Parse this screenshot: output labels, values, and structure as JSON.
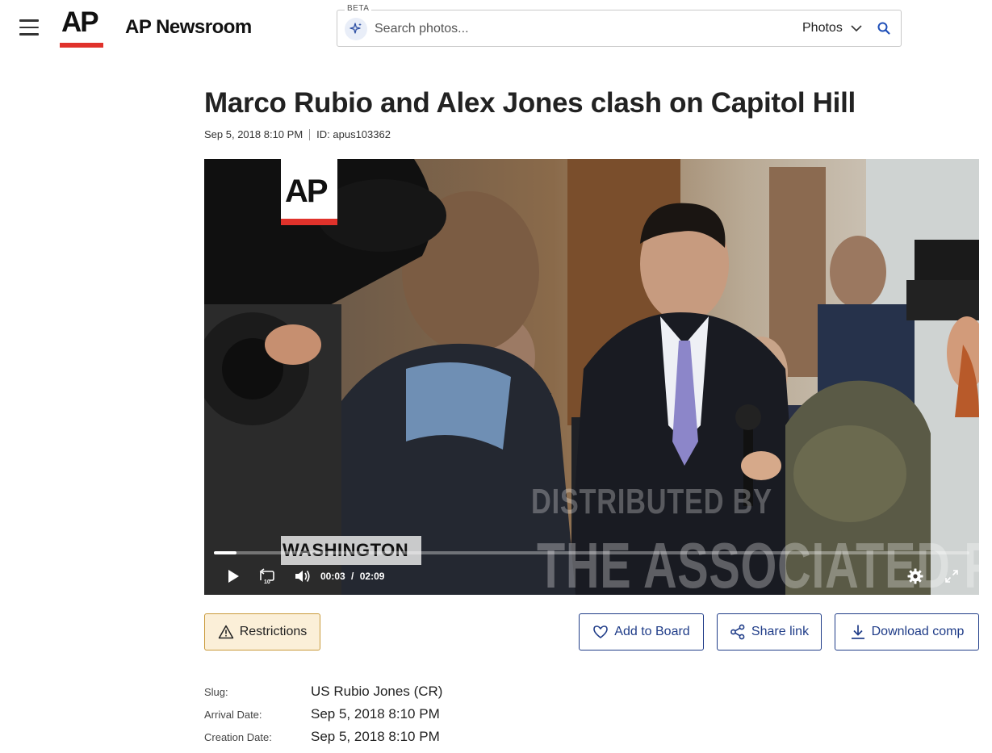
{
  "header": {
    "brand": "AP Newsroom",
    "logo_text": "AP",
    "search": {
      "beta_label": "BETA",
      "placeholder": "Search photos...",
      "scope": "Photos"
    }
  },
  "article": {
    "title": "Marco Rubio and Alex Jones clash on Capitol Hill",
    "date": "Sep 5, 2018 8:10 PM",
    "id_label": "ID: apus103362"
  },
  "video": {
    "logo_text": "AP",
    "watermark_line1": "DISTRIBUTED BY",
    "watermark_line2": "THE ASSOCIATED PRESS",
    "location": "WASHINGTON",
    "current_time": "00:03",
    "time_separator": "/",
    "duration": "02:09",
    "progress_fraction": 0.03,
    "skip_back_label": "10"
  },
  "actions": {
    "restrictions": "Restrictions",
    "add_to_board": "Add to Board",
    "share_link": "Share link",
    "download_comp": "Download comp"
  },
  "details": [
    {
      "label": "Slug:",
      "value": "US Rubio Jones (CR)"
    },
    {
      "label": "Arrival Date:",
      "value": "Sep 5, 2018 8:10 PM"
    },
    {
      "label": "Creation Date:",
      "value": "Sep 5, 2018 8:10 PM"
    }
  ],
  "colors": {
    "ap_red": "#e0322b",
    "link_blue": "#1f3c88",
    "restriction_bg": "#fbefd8",
    "restriction_border": "#c99a3a"
  },
  "icons": [
    "menu-icon",
    "ai-sparkle-icon",
    "chevron-down-icon",
    "search-icon",
    "play-icon",
    "replay-10-icon",
    "volume-icon",
    "settings-gear-icon",
    "fullscreen-icon",
    "warning-icon",
    "heart-icon",
    "share-icon",
    "download-icon"
  ]
}
